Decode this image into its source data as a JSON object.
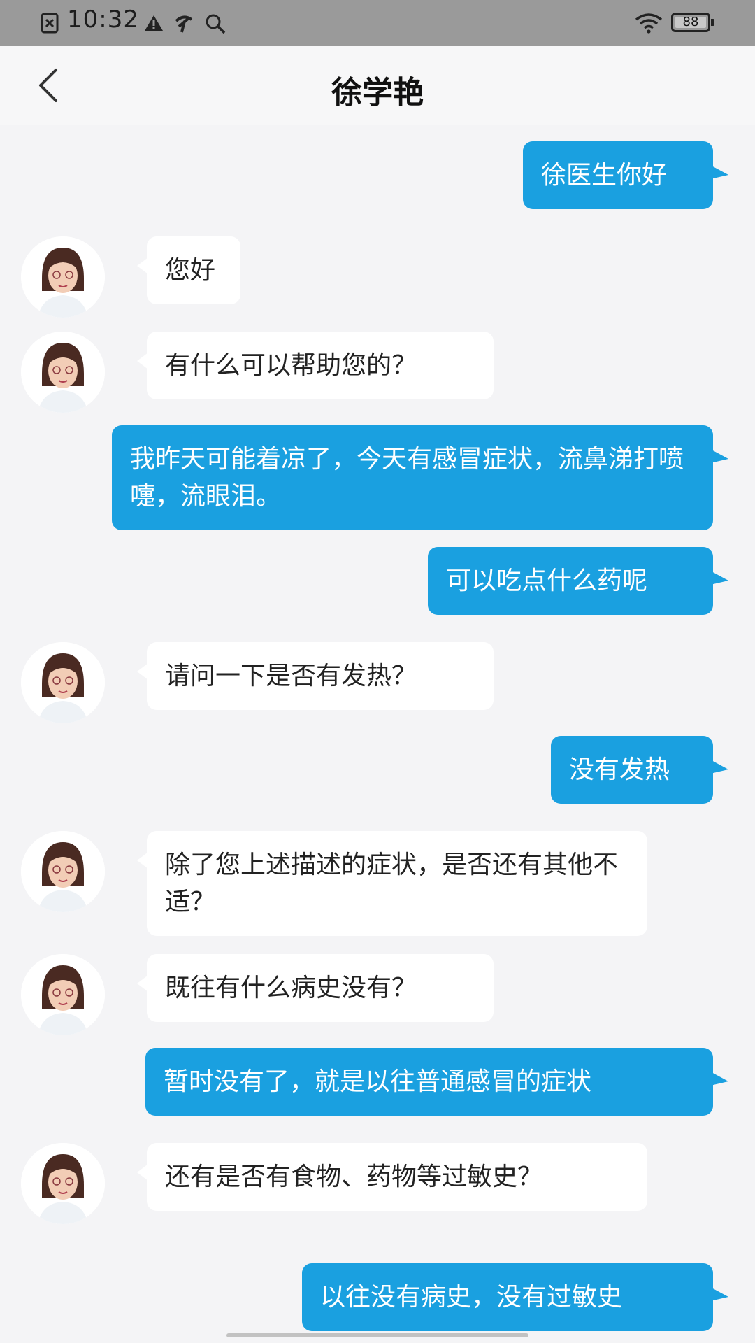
{
  "status_bar": {
    "time": "10:32",
    "battery": "88",
    "icons": [
      "notification-x-icon",
      "warning-icon",
      "carrier-icon",
      "search-icon",
      "wifi-icon",
      "battery-icon"
    ]
  },
  "header": {
    "title": "徐学艳",
    "back_icon": "chevron-left-icon"
  },
  "messages": [
    {
      "sender": "me",
      "text": "徐医生你好"
    },
    {
      "sender": "doctor",
      "text": "您好"
    },
    {
      "sender": "doctor",
      "text": "有什么可以帮助您的？"
    },
    {
      "sender": "me",
      "text": "我昨天可能着凉了，今天有感冒症状，流鼻涕打喷嚏，流眼泪。"
    },
    {
      "sender": "me",
      "text": "可以吃点什么药呢"
    },
    {
      "sender": "doctor",
      "text": "请问一下是否有发热？"
    },
    {
      "sender": "me",
      "text": "没有发热"
    },
    {
      "sender": "doctor",
      "text": "除了您上述描述的症状，是否还有其他不适？"
    },
    {
      "sender": "doctor",
      "text": "既往有什么病史没有？"
    },
    {
      "sender": "me",
      "text": "暂时没有了，就是以往普通感冒的症状"
    },
    {
      "sender": "doctor",
      "text": "还有是否有食物、药物等过敏史？"
    },
    {
      "sender": "me",
      "text": "以往没有病史，没有过敏史"
    }
  ],
  "colors": {
    "outgoing_bubble": "#1aa0e0",
    "incoming_bubble": "#ffffff",
    "background": "#f4f4f6",
    "status_bar": "#9a9a9a"
  }
}
